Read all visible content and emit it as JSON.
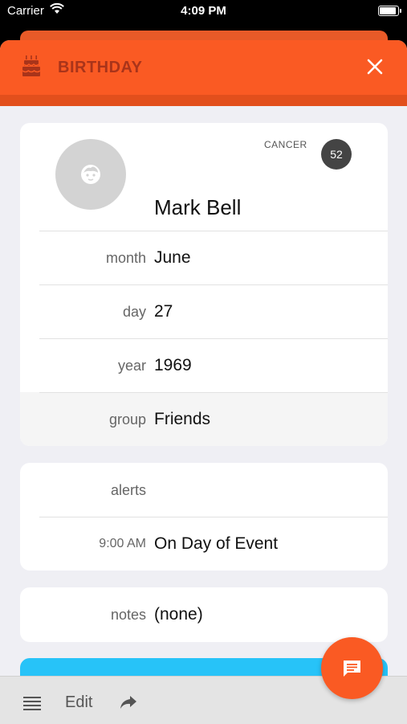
{
  "status_bar": {
    "carrier": "Carrier",
    "time": "4:09 PM"
  },
  "header": {
    "title": "BIRTHDAY",
    "icon": "birthday-cake-icon",
    "close_icon": "close-icon",
    "color": "#fa5a23"
  },
  "profile": {
    "name": "Mark Bell",
    "zodiac": "CANCER",
    "age": "52"
  },
  "details": [
    {
      "label": "month",
      "value": "June"
    },
    {
      "label": "day",
      "value": "27"
    },
    {
      "label": "year",
      "value": "1969"
    },
    {
      "label": "group",
      "value": "Friends"
    }
  ],
  "alerts": {
    "label": "alerts",
    "time": "9:00 AM",
    "value": "On Day of Event"
  },
  "notes": {
    "label": "notes",
    "value": "(none)"
  },
  "toolbar": {
    "edit_label": "Edit",
    "menu_icon": "hamburger-menu-icon",
    "share_icon": "share-arrow-icon"
  },
  "fab": {
    "icon": "chat-message-icon"
  }
}
